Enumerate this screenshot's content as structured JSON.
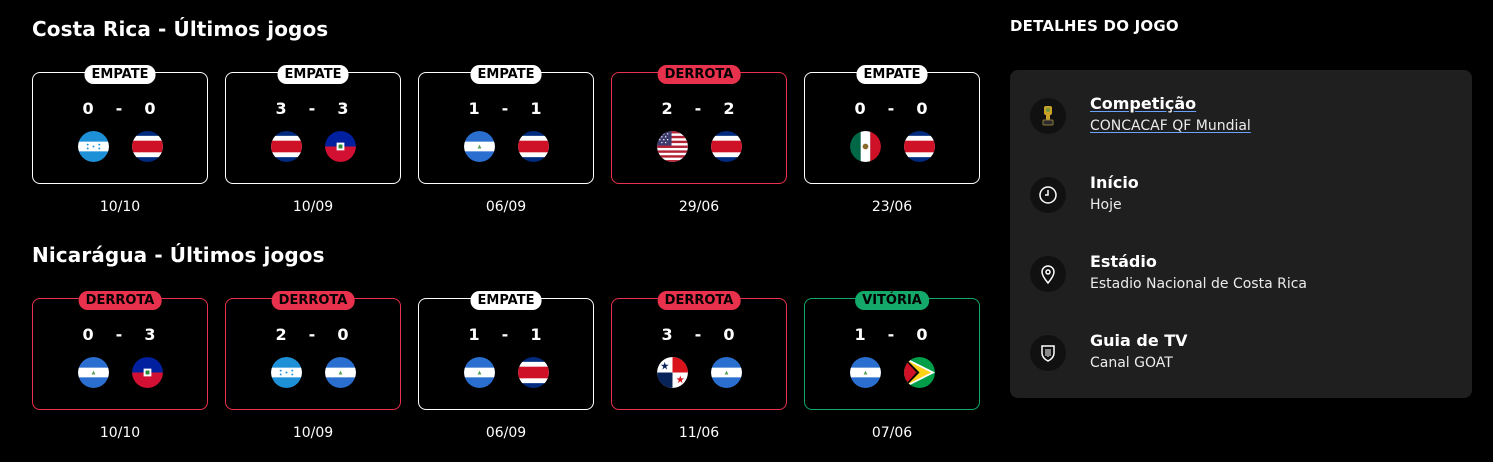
{
  "sections": [
    {
      "title": "Costa Rica - Últimos jogos",
      "matches": [
        {
          "result": "EMPATE",
          "kind": "draw",
          "home_score": "0",
          "sep": "-",
          "away_score": "0",
          "home_flag": "honduras-flag",
          "away_flag": "costa-rica-flag",
          "date": "10/10"
        },
        {
          "result": "EMPATE",
          "kind": "draw",
          "home_score": "3",
          "sep": "-",
          "away_score": "3",
          "home_flag": "costa-rica-flag",
          "away_flag": "haiti-flag",
          "date": "10/09"
        },
        {
          "result": "EMPATE",
          "kind": "draw",
          "home_score": "1",
          "sep": "-",
          "away_score": "1",
          "home_flag": "nicaragua-flag",
          "away_flag": "costa-rica-flag",
          "date": "06/09"
        },
        {
          "result": "DERROTA",
          "kind": "loss",
          "home_score": "2",
          "sep": "-",
          "away_score": "2",
          "home_flag": "usa-flag",
          "away_flag": "costa-rica-flag",
          "date": "29/06"
        },
        {
          "result": "EMPATE",
          "kind": "draw",
          "home_score": "0",
          "sep": "-",
          "away_score": "0",
          "home_flag": "mexico-flag",
          "away_flag": "costa-rica-flag",
          "date": "23/06"
        }
      ]
    },
    {
      "title": "Nicarágua - Últimos jogos",
      "matches": [
        {
          "result": "DERROTA",
          "kind": "loss",
          "home_score": "0",
          "sep": "-",
          "away_score": "3",
          "home_flag": "nicaragua-flag",
          "away_flag": "haiti-flag",
          "date": "10/10"
        },
        {
          "result": "DERROTA",
          "kind": "loss",
          "home_score": "2",
          "sep": "-",
          "away_score": "0",
          "home_flag": "honduras-flag",
          "away_flag": "nicaragua-flag",
          "date": "10/09"
        },
        {
          "result": "EMPATE",
          "kind": "draw",
          "home_score": "1",
          "sep": "-",
          "away_score": "1",
          "home_flag": "nicaragua-flag",
          "away_flag": "costa-rica-flag",
          "date": "06/09"
        },
        {
          "result": "DERROTA",
          "kind": "loss",
          "home_score": "3",
          "sep": "-",
          "away_score": "0",
          "home_flag": "panama-flag",
          "away_flag": "nicaragua-flag",
          "date": "11/06"
        },
        {
          "result": "VITÓRIA",
          "kind": "win",
          "home_score": "1",
          "sep": "-",
          "away_score": "0",
          "home_flag": "nicaragua-flag",
          "away_flag": "guyana-flag",
          "date": "07/06"
        }
      ]
    }
  ],
  "details": {
    "title": "DETALHES DO JOGO",
    "competition": {
      "label": "Competição",
      "value": "CONCACAF QF Mundial",
      "icon": "trophy-icon"
    },
    "start": {
      "label": "Início",
      "value": "Hoje",
      "icon": "clock-icon"
    },
    "stadium": {
      "label": "Estádio",
      "value": "Estadio Nacional de Costa Rica",
      "icon": "location-pin-icon"
    },
    "tv": {
      "label": "Guia de TV",
      "value": "Canal GOAT",
      "icon": "tv-shield-icon"
    }
  },
  "colors": {
    "loss": "#e8314c",
    "win": "#14a86a",
    "draw": "#ffffff",
    "panel": "#1f1f1f",
    "link_underline": "#6aa3ff"
  }
}
